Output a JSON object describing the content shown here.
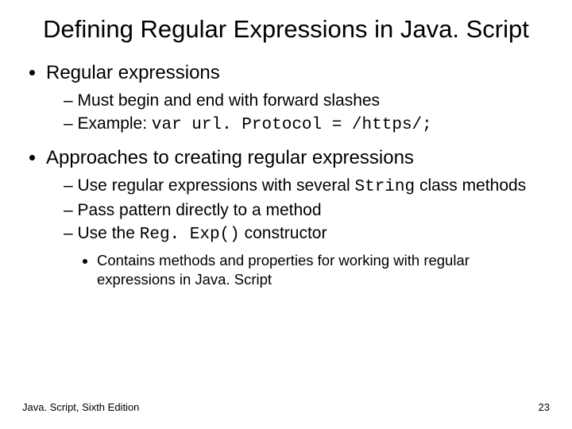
{
  "title": "Defining Regular Expressions in Java. Script",
  "bullets": {
    "b1": "Regular expressions",
    "b1_sub1": "Must begin and end with forward slashes",
    "b1_sub2_prefix": "Example: ",
    "b1_sub2_code": "var url. Protocol = /https/;",
    "b2": "Approaches to creating regular expressions",
    "b2_sub1_a": "Use regular expressions with several ",
    "b2_sub1_code": "String",
    "b2_sub1_b": " class methods",
    "b2_sub2": "Pass pattern directly to a method",
    "b2_sub3_a": "Use the ",
    "b2_sub3_code": "Reg. Exp()",
    "b2_sub3_b": " constructor",
    "b2_sub3_sub": "Contains methods and properties for working with regular expressions in Java. Script"
  },
  "footer": {
    "left": "Java. Script, Sixth Edition",
    "right": "23"
  }
}
